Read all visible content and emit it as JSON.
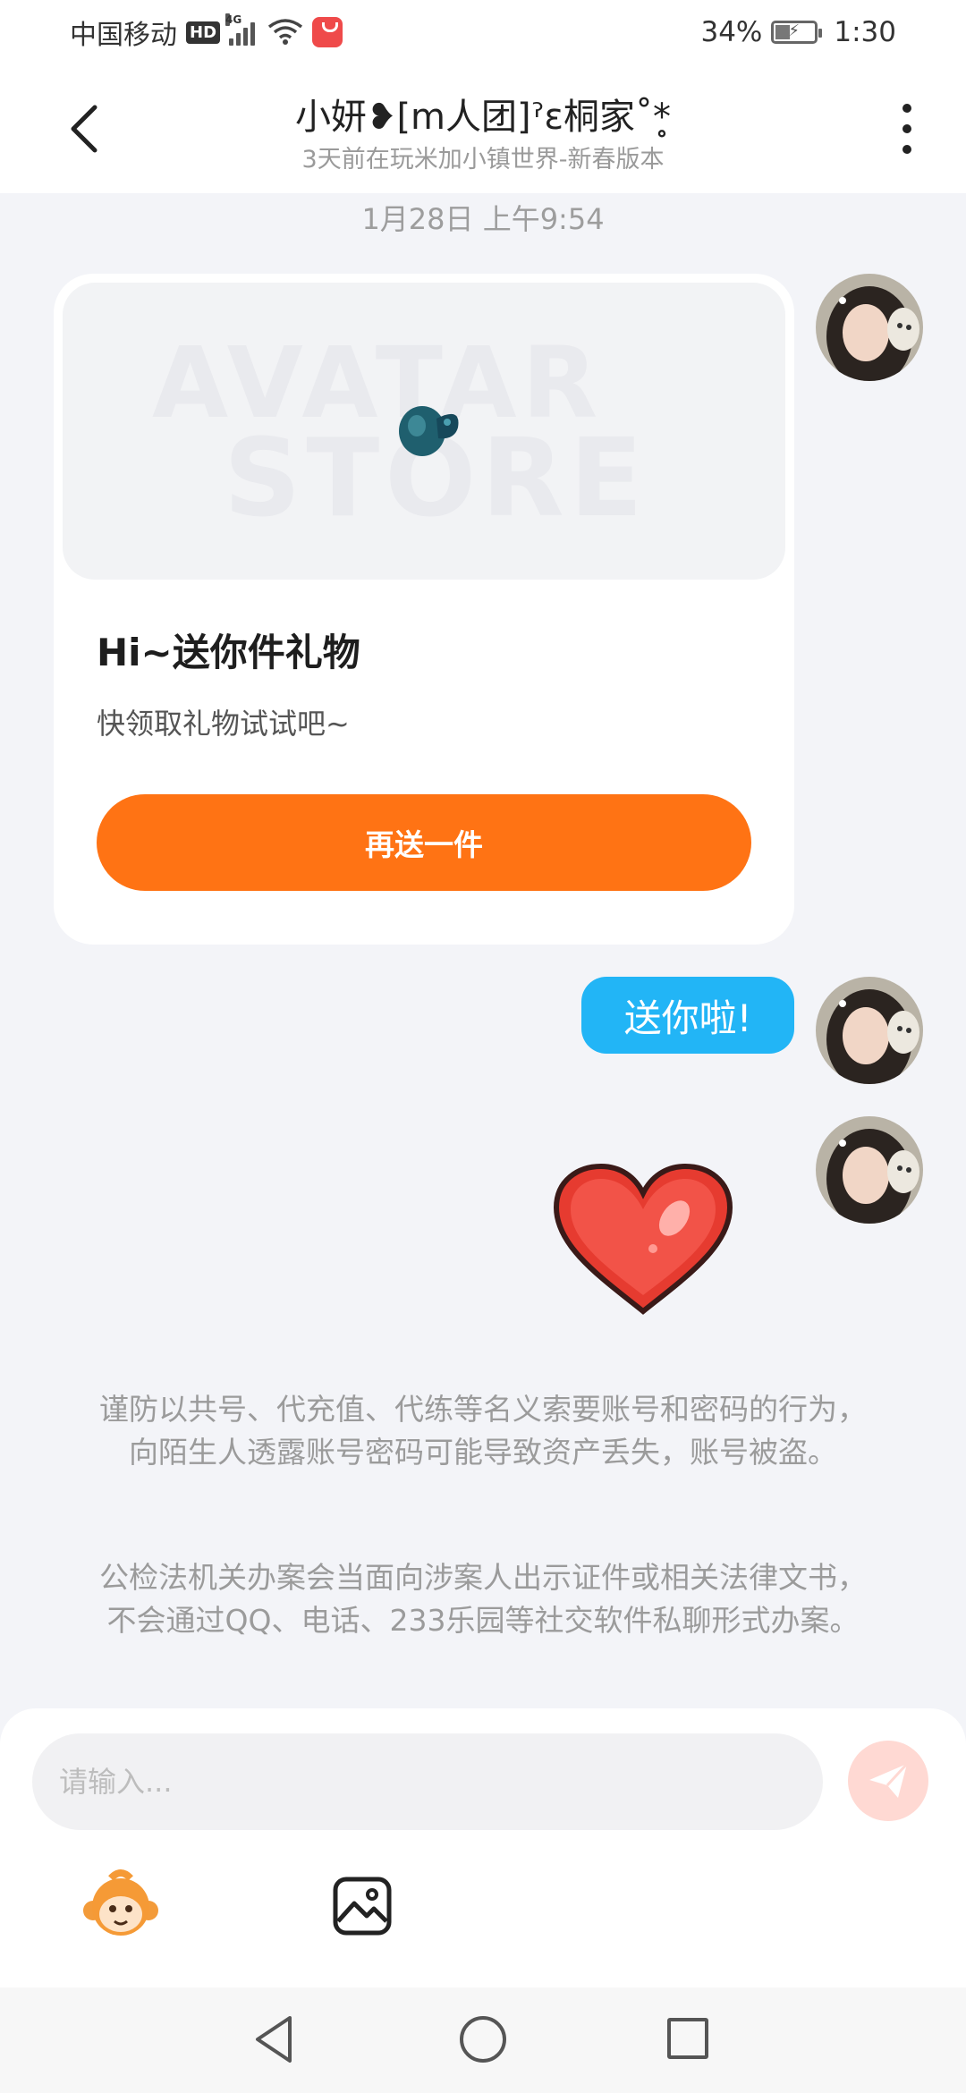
{
  "status_bar": {
    "carrier": "中国移动",
    "hd_label": "HD",
    "network": "4G",
    "battery_percent": "34%",
    "time": "1:30"
  },
  "header": {
    "title": "小妍❥[m人团]ˀɛ桐家˚*̥",
    "subtitle": "3天前在玩米加小镇世界-新春版本"
  },
  "chat": {
    "timestamp": "1月28日 上午9:54",
    "gift_card": {
      "watermark_line1": "AVATAR",
      "watermark_line2": "STORE",
      "title": "Hi~送你件礼物",
      "description": "快领取礼物试试吧~",
      "button_label": "再送一件"
    },
    "message_text": "送你啦!",
    "sticker": "heart-sticker"
  },
  "notices": [
    "谨防以共号、代充值、代练等名义索要账号和密码的行为，向陌生人透露账号密码可能导致资产丢失，账号被盗。",
    "公检法机关办案会当面向涉案人出示证件或相关法律文书，不会通过QQ、电话、233乐园等社交软件私聊形式办案。"
  ],
  "input": {
    "placeholder": "请输入..."
  },
  "colors": {
    "accent_orange": "#ff7314",
    "bubble_blue": "#22b5f6",
    "background": "#f3f4f8"
  }
}
